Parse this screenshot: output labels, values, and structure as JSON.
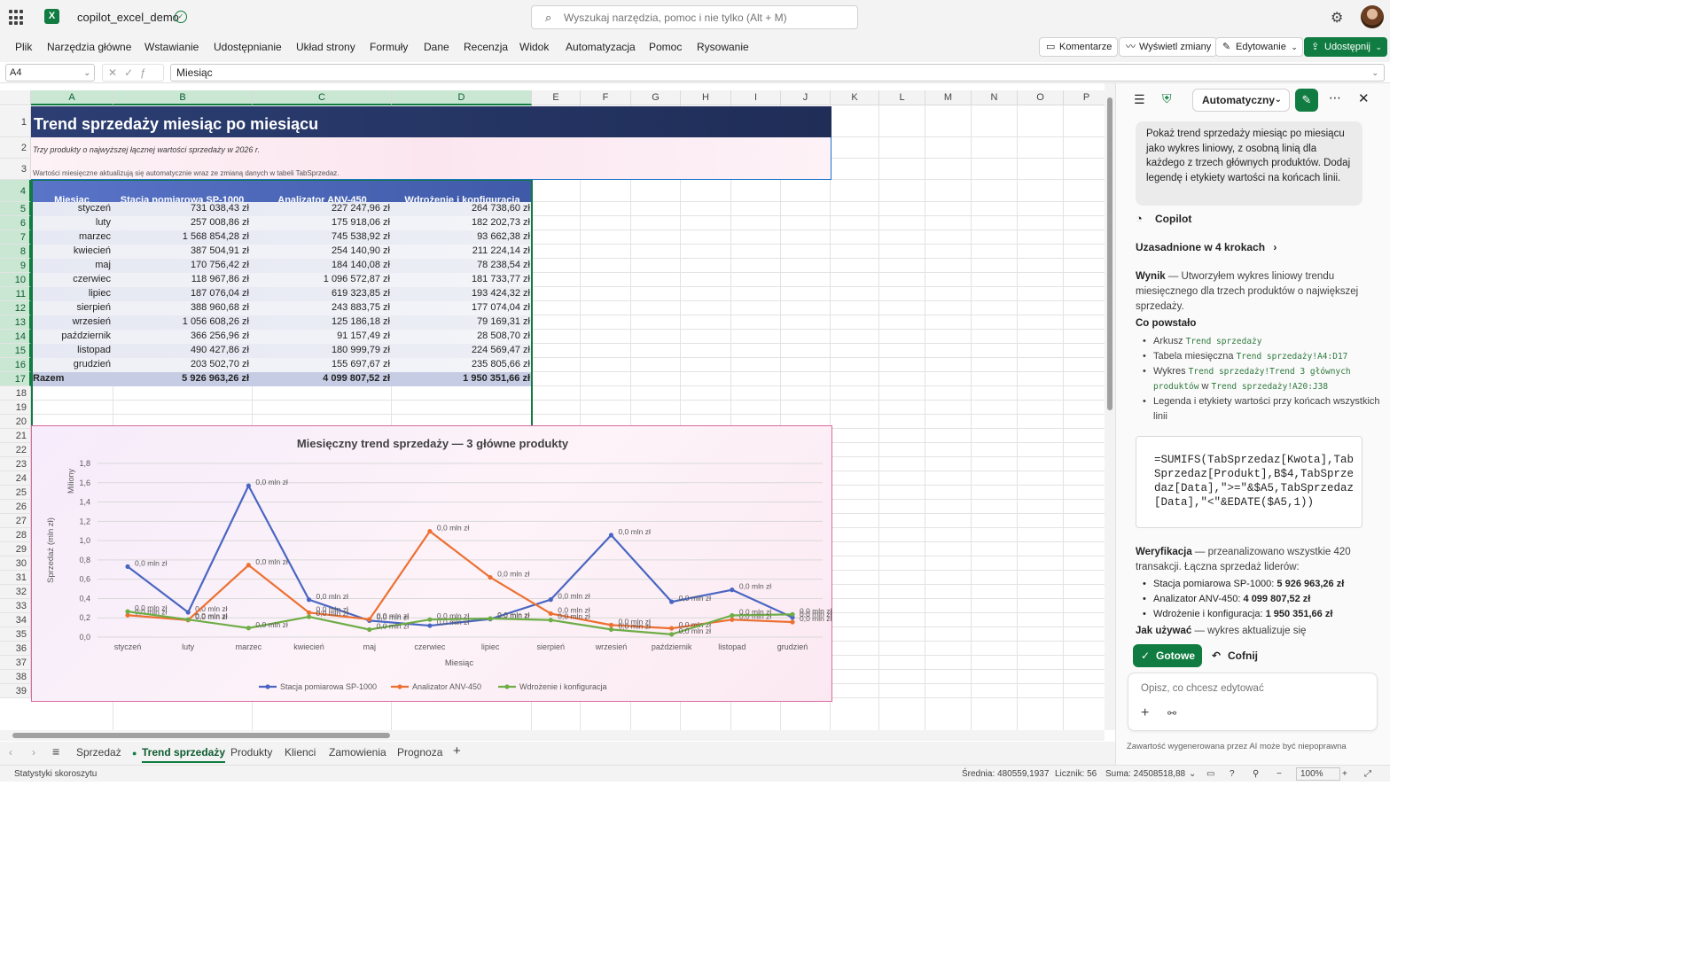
{
  "app": {
    "doc_name": "copilot_excel_demo",
    "search_placeholder": "Wyszukaj narzędzia, pomoc i nie tylko (Alt + M)"
  },
  "menu": {
    "items": [
      "Plik",
      "Narzędzia główne",
      "Wstawianie",
      "Udostępnianie",
      "Układ strony",
      "Formuły",
      "Dane",
      "Recenzja",
      "Widok",
      "Automatyzacja",
      "Pomoc",
      "Rysowanie"
    ],
    "comments": "Komentarze",
    "show_changes": "Wyświetl zmiany",
    "editing": "Edytowanie",
    "share": "Udostępnij"
  },
  "formula_bar": {
    "cell_ref": "A4",
    "content": "Miesiąc"
  },
  "grid": {
    "columns": [
      "A",
      "B",
      "C",
      "D",
      "E",
      "F",
      "G",
      "H",
      "I",
      "J",
      "K",
      "L",
      "M",
      "N",
      "O",
      "P"
    ],
    "rows": [
      "1",
      "2",
      "3",
      "4",
      "5",
      "6",
      "7",
      "8",
      "9",
      "10",
      "11",
      "12",
      "13",
      "14",
      "15",
      "16",
      "17",
      "18",
      "19",
      "20",
      "21",
      "22",
      "23",
      "24",
      "25",
      "26",
      "27",
      "28",
      "29",
      "30",
      "31",
      "32",
      "33",
      "34",
      "35",
      "36",
      "37",
      "38",
      "39"
    ]
  },
  "sheet": {
    "title": "Trend sprzedaży miesiąc po miesiącu",
    "subtitle": "Trzy produkty o najwyższej łącznej wartości sprzedaży w 2026 r.",
    "note": "Wartości miesięczne aktualizują się automatycznie wraz ze zmianą danych w tabeli TabSprzedaz.",
    "table": {
      "headers": [
        "Miesiąc",
        "Stacja pomiarowa SP-1000",
        "Analizator ANV-450",
        "Wdrożenie i konfiguracja"
      ],
      "rows": [
        [
          "styczeń",
          "731 038,43 zł",
          "227 247,96 zł",
          "264 738,60 zł"
        ],
        [
          "luty",
          "257 008,86 zł",
          "175 918,06 zł",
          "182 202,73 zł"
        ],
        [
          "marzec",
          "1 568 854,28 zł",
          "745 538,92 zł",
          "93 662,38 zł"
        ],
        [
          "kwiecień",
          "387 504,91 zł",
          "254 140,90 zł",
          "211 224,14 zł"
        ],
        [
          "maj",
          "170 756,42 zł",
          "184 140,08 zł",
          "78 238,54 zł"
        ],
        [
          "czerwiec",
          "118 967,86 zł",
          "1 096 572,87 zł",
          "181 733,77 zł"
        ],
        [
          "lipiec",
          "187 076,04 zł",
          "619 323,85 zł",
          "193 424,32 zł"
        ],
        [
          "sierpień",
          "388 960,68 zł",
          "243 883,75 zł",
          "177 074,04 zł"
        ],
        [
          "wrzesień",
          "1 056 608,26 zł",
          "125 186,18 zł",
          "79 169,31 zł"
        ],
        [
          "październik",
          "366 256,96 zł",
          "91 157,49 zł",
          "28 508,70 zł"
        ],
        [
          "listopad",
          "490 427,86 zł",
          "180 999,79 zł",
          "224 569,47 zł"
        ],
        [
          "grudzień",
          "203 502,70 zł",
          "155 697,67 zł",
          "235 805,66 zł"
        ]
      ],
      "total": [
        "Razem",
        "5 926 963,26 zł",
        "4 099 807,52 zł",
        "1 950 351,66 zł"
      ]
    }
  },
  "chart_data": {
    "type": "line",
    "title": "Miesięczny trend sprzedaży — 3 główne produkty",
    "xlabel": "Miesiąc",
    "ylabel": "Sprzedaż (mln zł)",
    "y_unit_label": "Miliony",
    "ylim": [
      0,
      1.8
    ],
    "yticks": [
      "0,0",
      "0,2",
      "0,4",
      "0,6",
      "0,8",
      "1,0",
      "1,2",
      "1,4",
      "1,6",
      "1,8"
    ],
    "grid": true,
    "legend": "bottom",
    "data_label": "0,0 mln zł",
    "categories": [
      "styczeń",
      "luty",
      "marzec",
      "kwiecień",
      "maj",
      "czerwiec",
      "lipiec",
      "sierpień",
      "wrzesień",
      "październik",
      "listopad",
      "grudzień"
    ],
    "series": [
      {
        "name": "Stacja pomiarowa SP-1000",
        "color": "#4a66c2",
        "values": [
          0.731,
          0.257,
          1.569,
          0.388,
          0.171,
          0.119,
          0.187,
          0.389,
          1.057,
          0.366,
          0.49,
          0.204
        ]
      },
      {
        "name": "Analizator ANV-450",
        "color": "#ed7032",
        "values": [
          0.227,
          0.176,
          0.746,
          0.254,
          0.184,
          1.097,
          0.619,
          0.244,
          0.125,
          0.091,
          0.181,
          0.156
        ]
      },
      {
        "name": "Wdrożenie i konfiguracja",
        "color": "#6fad47",
        "values": [
          0.265,
          0.182,
          0.094,
          0.211,
          0.078,
          0.182,
          0.193,
          0.177,
          0.079,
          0.029,
          0.225,
          0.236
        ]
      }
    ]
  },
  "sheet_tabs": {
    "items": [
      "Sprzedaż",
      "Trend sprzedaży",
      "Produkty",
      "Klienci",
      "Zamowienia",
      "Prognoza"
    ],
    "active": "Trend sprzedaży"
  },
  "status": {
    "left": "Statystyki skoroszytu",
    "average": "Średnia: 480559,1937",
    "count": "Licznik: 56",
    "sum": "Suma: 24508518,88",
    "zoom": "100%"
  },
  "copilot": {
    "mode": "Automatyczny",
    "user_prompt": "Pokaż trend sprzedaży miesiąc po miesiącu jako wykres liniowy, z osobną linią dla każdego z trzech głównych produktów. Dodaj legendę i etykiety wartości na końcach linii.",
    "label": "Copilot",
    "grounded": "Uzasadnione w 4 krokach",
    "result_title": "Wynik",
    "result_text": " — Utworzyłem wykres liniowy trendu miesięcznego dla trzech produktów o największej sprzedaży.",
    "created_title": "Co powstało",
    "created": [
      {
        "text": "Arkusz ",
        "code": "Trend sprzedaży",
        "tail": ""
      },
      {
        "text": "Tabela miesięczna ",
        "code": "Trend sprzedaży!A4:D17",
        "tail": ""
      },
      {
        "text": "Wykres ",
        "code": "Trend sprzedaży!Trend 3 głównych produktów",
        "tail": " w ",
        "code2": "Trend sprzedaży!A20:J38"
      },
      {
        "text": "Legenda i etykiety wartości przy końcach wszystkich linii",
        "code": "",
        "tail": ""
      }
    ],
    "formula": "=SUMIFS(TabSprzedaz[Kwota],TabSprzedaz[Produkt],B$4,TabSprzedaz[Data],\">=\"&$A5,TabSprzedaz[Data],\"<\"&EDATE($A5,1))",
    "verify_title": "Weryfikacja",
    "verify_text": " — przeanalizowano wszystkie 420 transakcji. Łączna sprzedaż liderów:",
    "verify": [
      {
        "label": "Stacja pomiarowa SP-1000: ",
        "value": "5 926 963,26 zł"
      },
      {
        "label": "Analizator ANV-450: ",
        "value": "4 099 807,52 zł"
      },
      {
        "label": "Wdrożenie i konfiguracja: ",
        "value": "1 950 351,66 zł"
      }
    ],
    "usage_title": "Jak używać",
    "usage_text": " — wykres aktualizuje się",
    "done": "Gotowe",
    "undo": "Cofnij",
    "input_placeholder": "Opisz, co chcesz edytować",
    "disclaimer": "Zawartość wygenerowana przez AI może być niepoprawna"
  }
}
